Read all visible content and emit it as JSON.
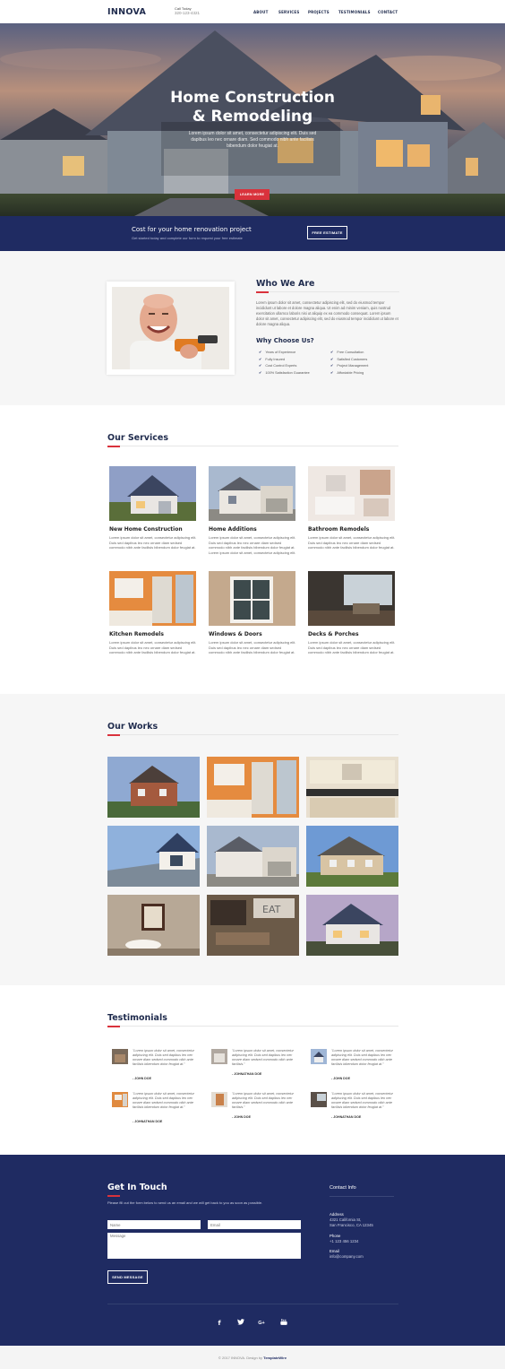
{
  "nav": {
    "logo": "INNOVA",
    "call_label": "Call Today",
    "call_phone": "320-123-4321",
    "links": [
      "ABOUT",
      "SERVICES",
      "PROJECTS",
      "TESTIMONIALS",
      "CONTACT"
    ]
  },
  "hero": {
    "title_line1": "Home Construction",
    "title_line2": "& Remodeling",
    "subtitle": "Lorem ipsum dolor sit amet, consectetur adipiscing elit. Duis sed dapibus leo nec ornare diam. Sed commodo nibh ante facilisis bibendum dolor feugiat at.",
    "button": "LEARN MORE"
  },
  "cta": {
    "title": "Cost for your home renovation project",
    "subtitle": "Get started today and complete our form to request your free estimate",
    "button": "FREE ESTIMATE"
  },
  "who": {
    "title": "Who We Are",
    "text": "Lorem ipsum dolor sit amet, consectetur adipiscing elit, sed do eiusmod tempor incididunt ut labore et dolore magna aliqua. Ut enim ad minim veniam, quis nostrud exercitation ullamco laboris nisi ut aliquip ex ea commodo consequat. Lorem ipsum dolor sit amet, consectetur adipiscing elit, sed do eiusmod tempor incididunt ut labore et dolore magna aliqua.",
    "why_title": "Why Choose Us?",
    "why_left": [
      "Years of Experience",
      "Fully Insured",
      "Cost Control Experts",
      "100% Satisfaction Guarantee"
    ],
    "why_right": [
      "Free Consultation",
      "Satisfied Customers",
      "Project Management",
      "Affordable Pricing"
    ]
  },
  "services": {
    "title": "Our Services",
    "items": [
      {
        "title": "New Home Construction",
        "text": "Lorem ipsum dolor sit amet, consectetur adipiscing elit. Duis sed dapibus leo nec ornare diam sedsed commodo nibh ante facilisis bibendum dolor feugiat at."
      },
      {
        "title": "Home Additions",
        "text": "Lorem ipsum dolor sit amet, consectetur adipiscing elit. Duis sed dapibus leo nec ornare diam sedsed commodo nibh ante facilisis bibendum dolor feugiat at. Lorem ipsum dolor sit amet, consectetur adipiscing elit."
      },
      {
        "title": "Bathroom Remodels",
        "text": "Lorem ipsum dolor sit amet, consectetur adipiscing elit. Duis sed dapibus leo nec ornare diam sedsed commodo nibh ante facilisis bibendum dolor feugiat at."
      },
      {
        "title": "Kitchen Remodels",
        "text": "Lorem ipsum dolor sit amet, consectetur adipiscing elit. Duis sed dapibus leo nec ornare diam sedsed commodo nibh ante facilisis bibendum dolor feugiat at."
      },
      {
        "title": "Windows & Doors",
        "text": "Lorem ipsum dolor sit amet, consectetur adipiscing elit. Duis sed dapibus leo nec ornare diam sedsed commodo nibh ante facilisis bibendum dolor feugiat at."
      },
      {
        "title": "Decks & Porches",
        "text": "Lorem ipsum dolor sit amet, consectetur adipiscing elit. Duis sed dapibus leo nec ornare diam sedsed commodo nibh ante facilisis bibendum dolor feugiat at."
      }
    ]
  },
  "works": {
    "title": "Our Works"
  },
  "testimonials": {
    "title": "Testimonials",
    "items": [
      {
        "quote": "\"Lorem ipsum dolor sit amet, consectetur adipiscing elit. Duis sed dapibus leo nec ornare diam sedsed commodo nibh ante facilisis bibendum dolor feugiat at.\"",
        "author": "- JOHN DOE"
      },
      {
        "quote": "\"Lorem ipsum dolor sit amet, consectetur adipiscing elit. Duis sed dapibus leo nec ornare diam sedsed commodo nibh ante facilisis.\"",
        "author": "- JOHNATHAN DOE"
      },
      {
        "quote": "\"Lorem ipsum dolor sit amet, consectetur adipiscing elit. Duis sed dapibus leo nec ornare diam sedsed commodo nibh ante facilisis bibendum dolor feugiat at.\"",
        "author": "- JOHN DOE"
      },
      {
        "quote": "\"Lorem ipsum dolor sit amet, consectetur adipiscing elit. Duis sed dapibus leo nec ornare diam sedsed commodo nibh ante facilisis bibendum dolor feugiat at.\"",
        "author": "- JOHNATHAN DOE"
      },
      {
        "quote": "\"Lorem ipsum dolor sit amet, consectetur adipiscing elit. Duis sed dapibus leo nec ornare diam sedsed commodo nibh ante facilisis.\"",
        "author": "- JOHN DOE"
      },
      {
        "quote": "\"Lorem ipsum dolor sit amet, consectetur adipiscing elit. Duis sed dapibus leo nec ornare diam sedsed commodo nibh ante facilisis bibendum dolor feugiat at.\"",
        "author": "- JOHNATHAN DOE"
      }
    ]
  },
  "contact": {
    "title": "Get In Touch",
    "subtitle": "Please fill out the form below to send us an email and we will get back to you as soon as possible.",
    "name_placeholder": "Name",
    "email_placeholder": "Email",
    "message_placeholder": "Message",
    "send": "SEND MESSAGE",
    "info_title": "Contact Info",
    "address_label": "Address",
    "address_line1": "4321 California St,",
    "address_line2": "San Francisco, CA 12345",
    "phone_label": "Phone",
    "phone": "+1 123 456 1234",
    "email_label": "Email",
    "email": "info@company.com",
    "social_icons": [
      "facebook-icon",
      "twitter-icon",
      "google-plus-icon",
      "youtube-icon"
    ]
  },
  "footer": {
    "text": "© 2017 INNOVA. Design by",
    "brand": "TemplateWire"
  },
  "colors": {
    "navy": "#1f2b62",
    "accent_red": "#d9323c",
    "heading": "#1f2b4d"
  }
}
